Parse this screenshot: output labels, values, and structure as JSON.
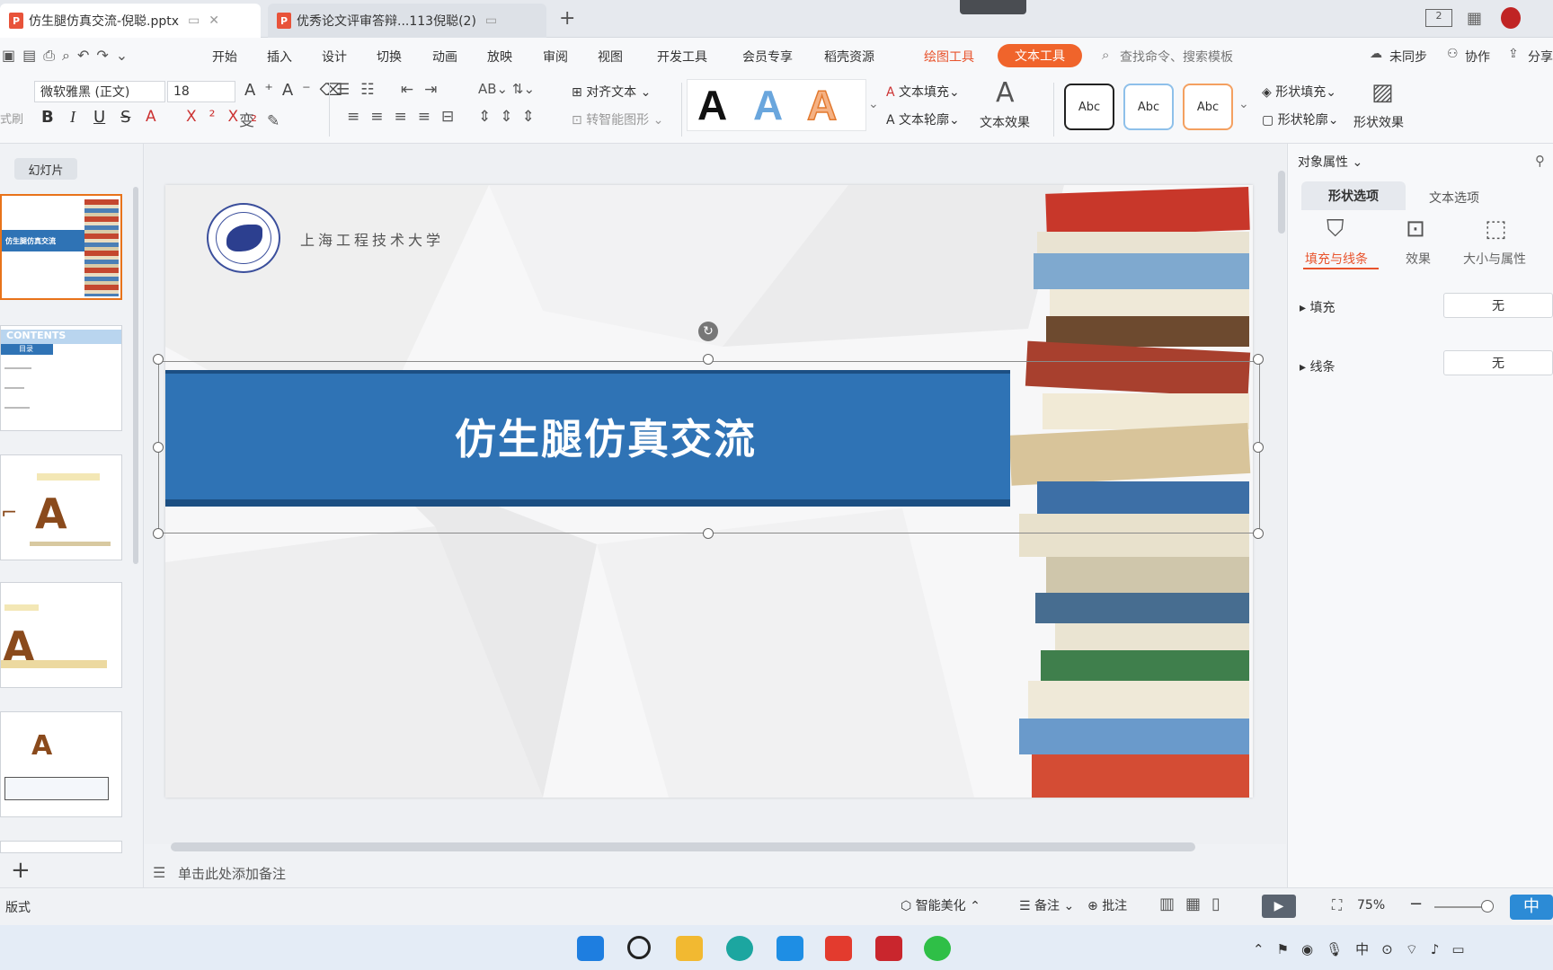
{
  "tabs": [
    {
      "label": "仿生腿仿真交流-倪聪.pptx",
      "icon": "P"
    },
    {
      "label": "优秀论文评审答辩...113倪聪(2)",
      "icon": "P"
    }
  ],
  "menu": {
    "items": [
      "开始",
      "插入",
      "设计",
      "切换",
      "动画",
      "放映",
      "审阅",
      "视图",
      "开发工具",
      "会员专享",
      "稻壳资源"
    ],
    "drawing_tool": "绘图工具",
    "text_tool": "文本工具",
    "search_placeholder": "查找命令、搜索模板",
    "unsynced": "未同步",
    "collab": "协作",
    "share": "分享"
  },
  "ribbon": {
    "font_name": "微软雅黑 (正文)",
    "font_size": "18",
    "align_text": "对齐文本",
    "smart_shape": "转智能图形",
    "text_fill": "文本填充",
    "text_outline": "文本轮廓",
    "text_effect": "文本效果",
    "style_A": "A",
    "abc": "Abc",
    "shape_fill": "形状填充",
    "shape_outline": "形状轮廓",
    "shape_effect": "形状效果",
    "format_painter": "式刷",
    "bold": "B",
    "italic": "I",
    "underline": "U",
    "strike": "S"
  },
  "left_panel": {
    "title": "幻灯片",
    "thumb1_text": "仿生腿仿真交流",
    "thumb2_text": "目录",
    "thumb2_header": "CONTENTS"
  },
  "slide": {
    "university": "上海工程技术大学",
    "title": "仿生腿仿真交流"
  },
  "notes_placeholder": "单击此处添加备注",
  "right_panel": {
    "title": "对象属性",
    "tab_shape": "形状选项",
    "tab_text": "文本选项",
    "sub_fill_line": "填充与线条",
    "sub_effect": "效果",
    "sub_size": "大小与属性",
    "fill_label": "填充",
    "fill_value": "无",
    "line_label": "线条",
    "line_value": "无"
  },
  "status": {
    "layout": "版式",
    "beautify": "智能美化",
    "notes": "备注",
    "comments": "批注",
    "zoom": "75%",
    "ime": "中"
  },
  "colors": {
    "accent": "#f0642b",
    "banner": "#2f73b5",
    "banner_dark": "#1c4f83"
  }
}
